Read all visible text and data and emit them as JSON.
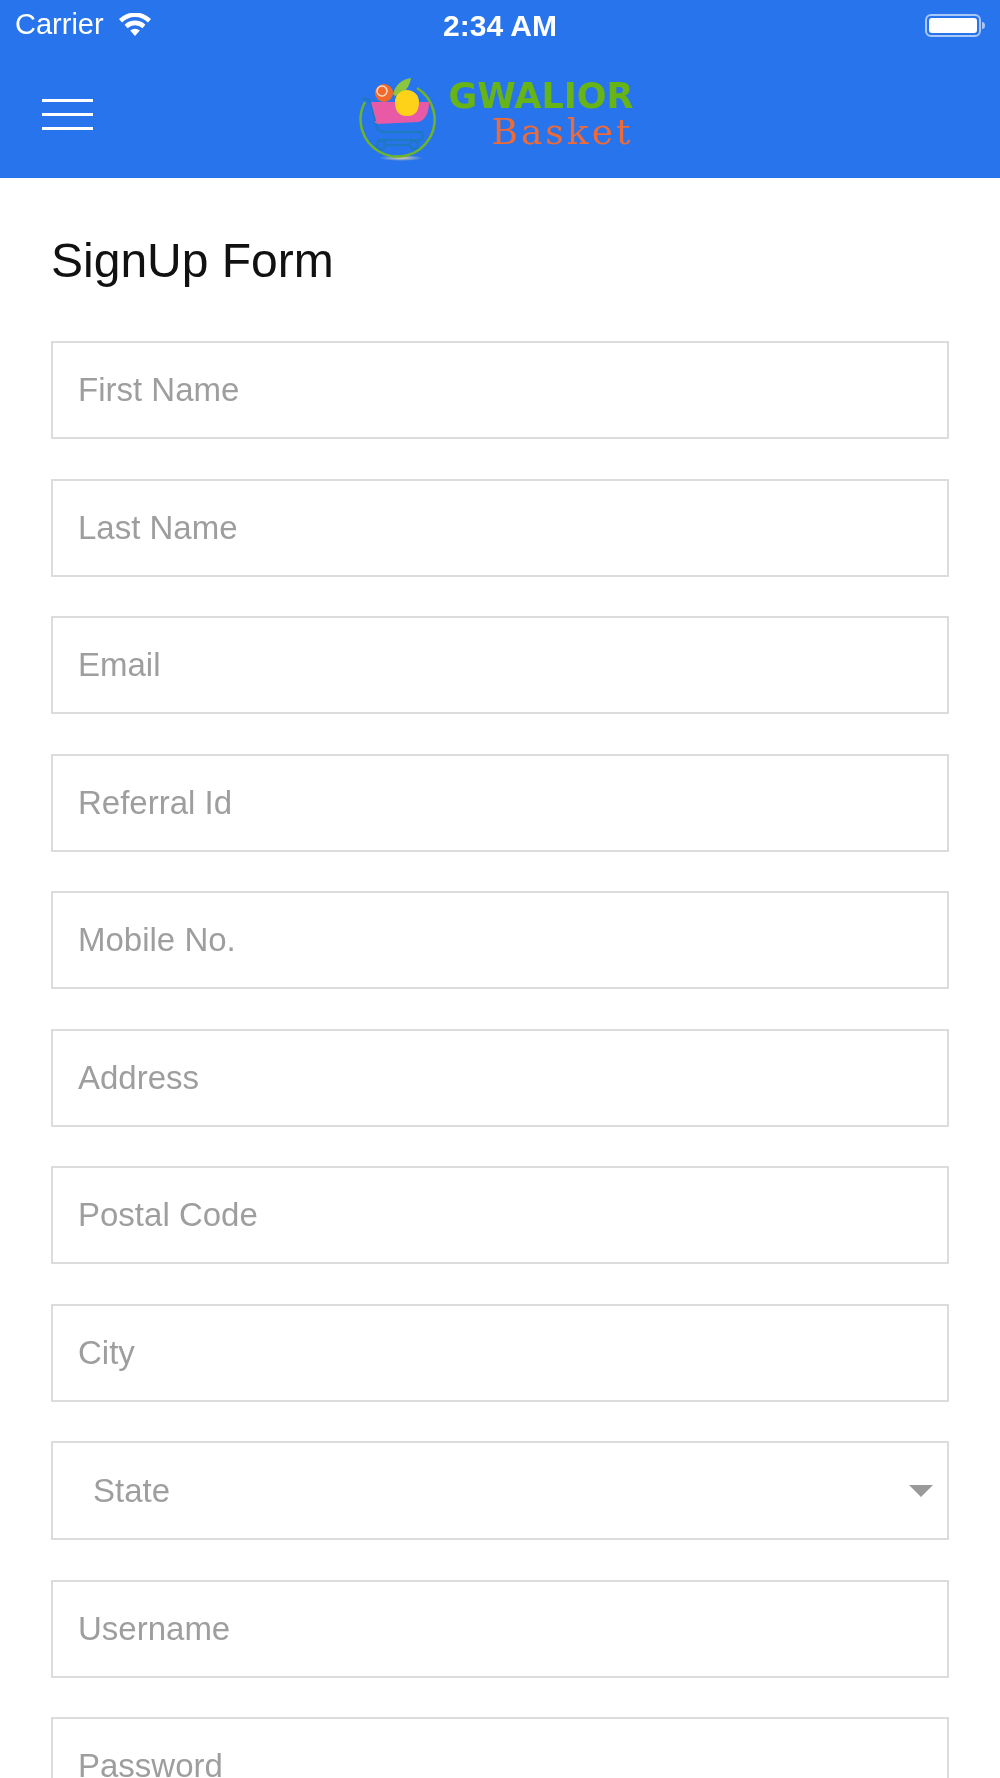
{
  "status_bar": {
    "carrier": "Carrier",
    "time": "2:34 AM"
  },
  "header": {
    "logo": {
      "top_text": "GWALIOR",
      "bottom_text": "Basket"
    }
  },
  "form": {
    "title": "SignUp Form",
    "fields": [
      {
        "kind": "text",
        "placeholder": "First Name"
      },
      {
        "kind": "text",
        "placeholder": "Last Name"
      },
      {
        "kind": "text",
        "placeholder": "Email"
      },
      {
        "kind": "text",
        "placeholder": "Referral Id"
      },
      {
        "kind": "text",
        "placeholder": "Mobile No."
      },
      {
        "kind": "text",
        "placeholder": "Address"
      },
      {
        "kind": "text",
        "placeholder": "Postal Code"
      },
      {
        "kind": "text",
        "placeholder": "City"
      },
      {
        "kind": "select",
        "placeholder": "State"
      },
      {
        "kind": "text",
        "placeholder": "Username"
      },
      {
        "kind": "password",
        "placeholder": "Password"
      }
    ]
  }
}
